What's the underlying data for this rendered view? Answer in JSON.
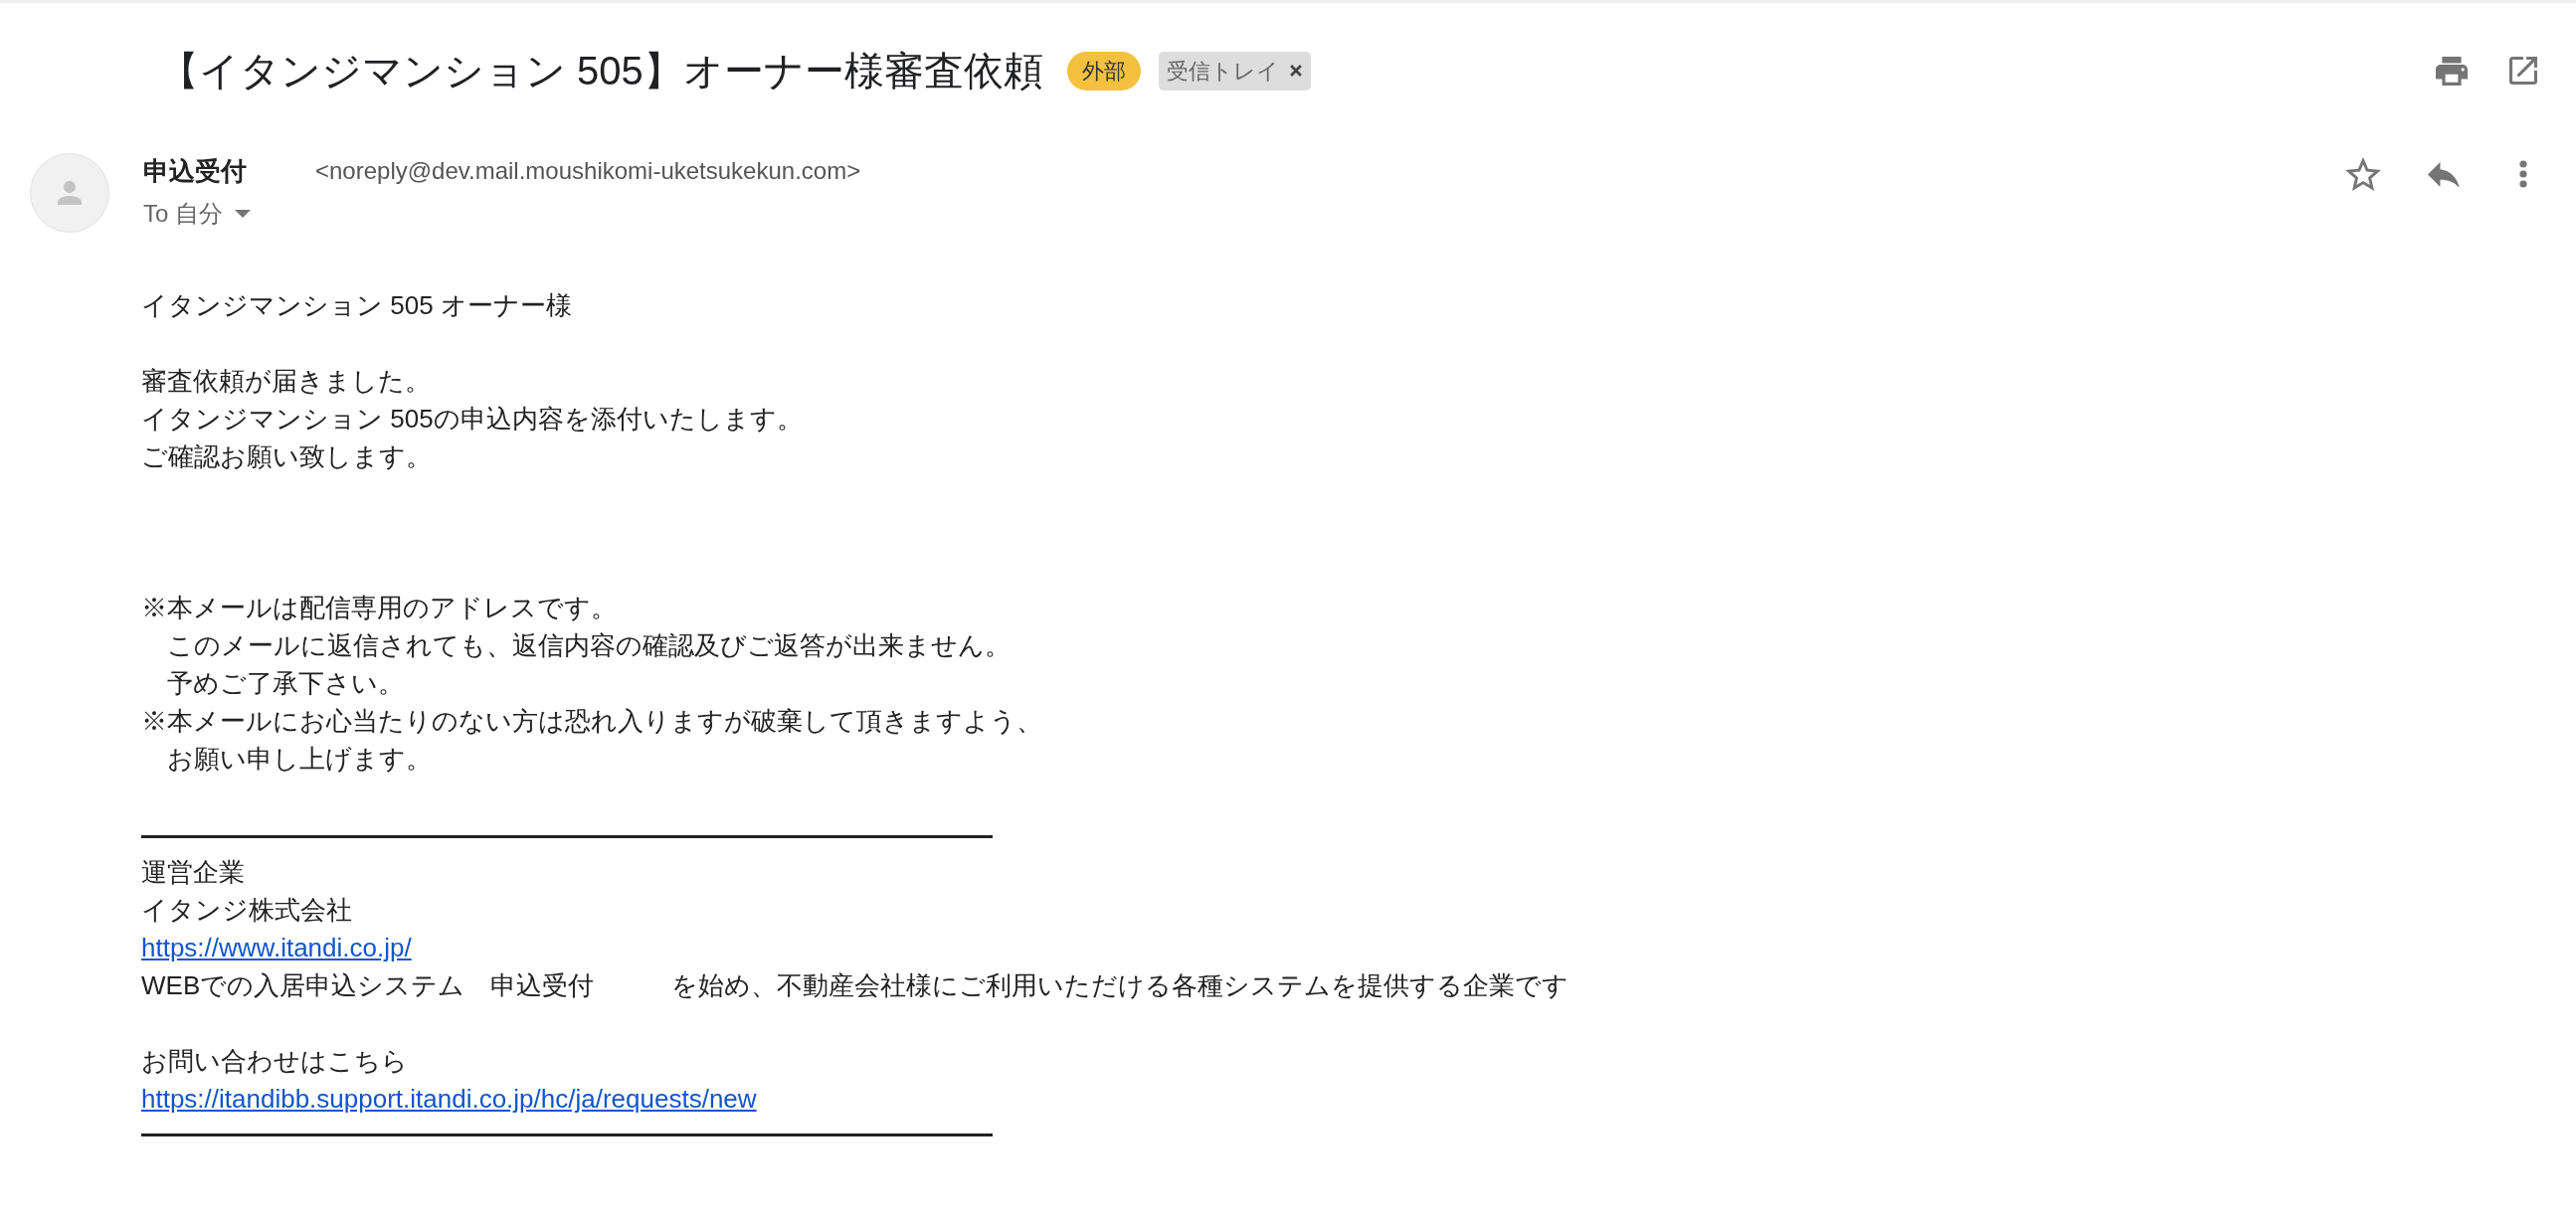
{
  "subject": {
    "title": "【イタンジマンション 505】オーナー様審査依頼",
    "labels": [
      {
        "text": "外部",
        "kind": "external",
        "removable": false
      },
      {
        "text": "受信トレイ",
        "kind": "inbox",
        "removable": true
      }
    ]
  },
  "sender": {
    "name": "申込受付",
    "email": "<noreply@dev.mail.moushikomi-uketsukekun.com>",
    "recipient": "To 自分",
    "starred": false
  },
  "body": {
    "greeting": "イタンジマンション 505 オーナー様",
    "message": [
      "審査依頼が届きました。",
      "イタンジマンション 505の申込内容を添付いたします。",
      "ご確認お願い致します。"
    ],
    "notices": [
      {
        "lines": [
          "※本メールは配信専用のアドレスです。",
          "このメールに返信されても、返信内容の確認及びご返答が出来ません。",
          "予めご了承下さい。"
        ]
      },
      {
        "lines": [
          "※本メールにお心当たりのない方は恐れ入りますが破棄して頂きますよう、",
          "お願い申し上げます。"
        ]
      }
    ]
  },
  "signature": {
    "company_label": "運営企業",
    "company_name": "イタンジ株式会社",
    "website": "https://www.itandi.co.jp/",
    "description": "WEBでの入居申込システム　申込受付　　　を始め、不動産会社様にご利用いただける各種システムを提供する企業です",
    "contact_label": "お問い合わせはこちら",
    "contact_link": "https://itandibb.support.itandi.co.jp/hc/ja/requests/new"
  }
}
